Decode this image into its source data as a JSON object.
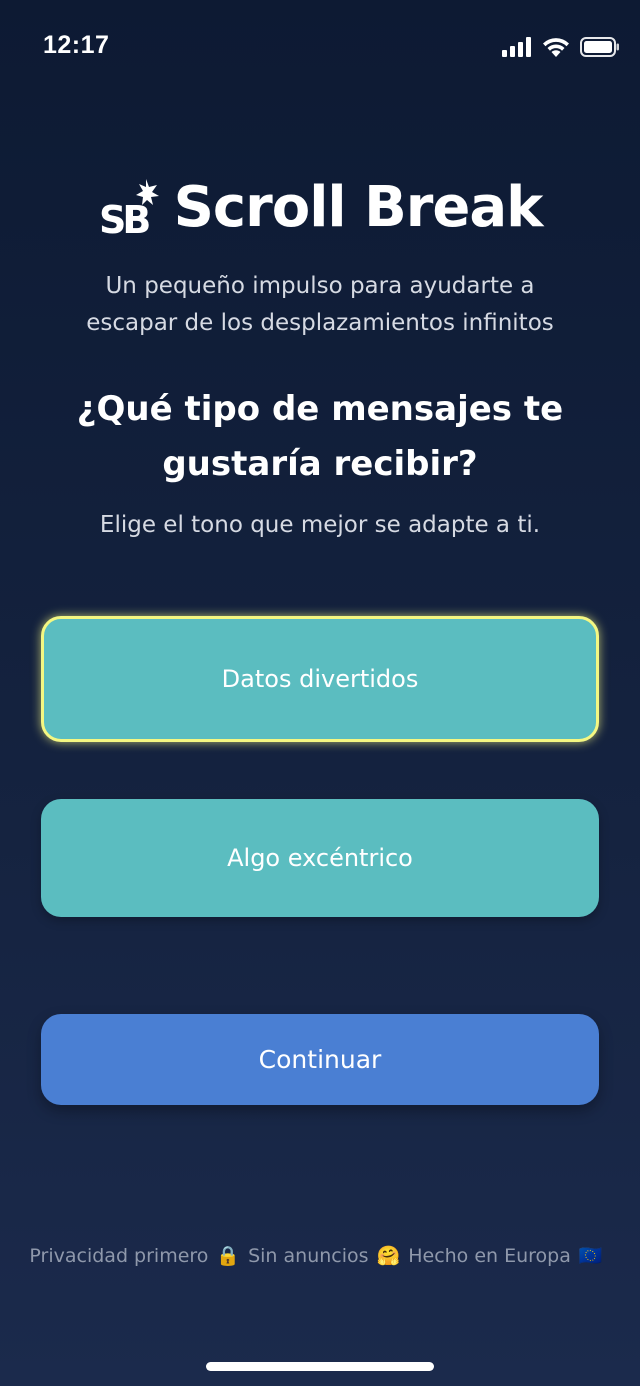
{
  "status_bar": {
    "time": "12:17"
  },
  "header": {
    "logo_text": "SB",
    "title": "Scroll Break"
  },
  "tagline": {
    "line1": "Un pequeño impulso para ayudarte a",
    "line2": "escapar de los desplazamientos infinitos"
  },
  "question": {
    "line1": "¿Qué tipo de mensajes te",
    "line2": "gustaría recibir?"
  },
  "subtitle": "Elige el tono que mejor se adapte a ti.",
  "options": [
    {
      "label": "Datos divertidos",
      "selected": true
    },
    {
      "label": "Algo excéntrico",
      "selected": false
    }
  ],
  "continue_label": "Continuar",
  "footer": {
    "privacy": "Privacidad primero",
    "privacy_emoji": "🔒",
    "no_ads": "Sin anuncios",
    "no_ads_emoji": "🤗",
    "made_in": "Hecho en Europa",
    "made_in_emoji": "🇪🇺"
  },
  "colors": {
    "background_top": "#0d1a33",
    "option_fill": "#5bbdc0",
    "selected_outline": "#f4f782",
    "continue_fill": "#4a7fd3"
  },
  "icons": [
    "signal-icon",
    "wifi-icon",
    "battery-icon",
    "logo-icon"
  ]
}
